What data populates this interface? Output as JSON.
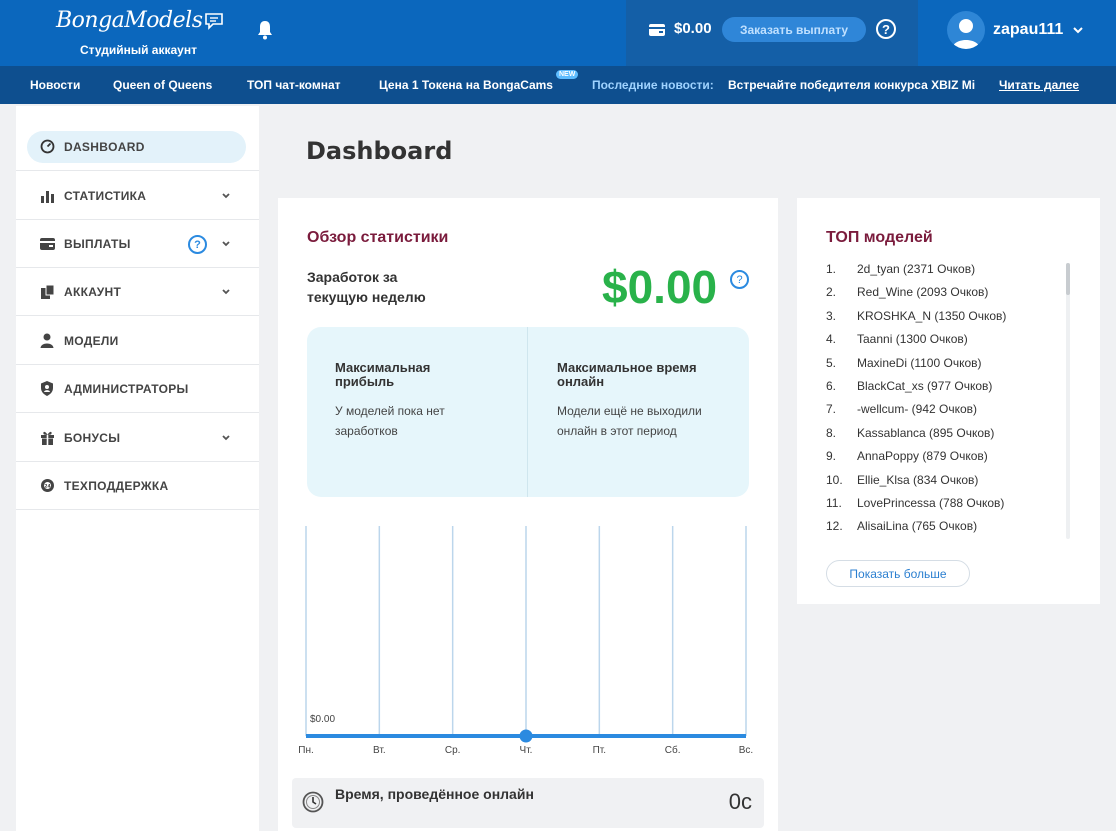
{
  "header": {
    "logo_text": "BongaModels",
    "logo_sub": "Студийный аккаунт",
    "balance": "$0.00",
    "payout_button": "Заказать выплату",
    "help": "?",
    "username": "zapau111",
    "colors": {
      "primary": "#0b67bd",
      "dark": "#0e4f8f"
    }
  },
  "newsbar": {
    "links": [
      "Новости",
      "Queen of Queens",
      "ТОП чат-комнат",
      "Цена 1 Токена на BongaCams"
    ],
    "new_badge": "NEW",
    "label": "Последние новости:",
    "text": "Встречайте победителя конкурса XBIZ Mi",
    "read_more": "Читать далее"
  },
  "sidebar": {
    "items": [
      {
        "label": "DASHBOARD",
        "icon": "dashboard-icon",
        "active": true
      },
      {
        "label": "СТАТИСТИКА",
        "icon": "bar-chart-icon",
        "expandable": true
      },
      {
        "label": "ВЫПЛАТЫ",
        "icon": "card-icon",
        "expandable": true,
        "help": "?"
      },
      {
        "label": "АККАУНТ",
        "icon": "account-icon",
        "expandable": true
      },
      {
        "label": "МОДЕЛИ",
        "icon": "user-icon"
      },
      {
        "label": "АДМИНИСТРАТОРЫ",
        "icon": "shield-icon"
      },
      {
        "label": "БОНУСЫ",
        "icon": "gift-icon",
        "expandable": true
      },
      {
        "label": "ТЕХПОДДЕРЖКА",
        "icon": "support-icon"
      }
    ]
  },
  "main": {
    "title": "Dashboard",
    "stats": {
      "title": "Обзор статистики",
      "earn_label": "Заработок за текущую неделю",
      "earn_value": "$0.00",
      "help": "?",
      "max_profit_title": "Максимальная прибыль",
      "max_profit_text": "У моделей пока нет заработков",
      "max_time_title": "Максимальное время онлайн",
      "max_time_text": "Модели ещё не выходили онлайн в этот период",
      "online_label": "Время, проведённое онлайн",
      "online_value": "0с"
    },
    "top": {
      "title": "ТОП моделей",
      "items": [
        "2d_tyan (2371 Очков)",
        "Red_Wine (2093 Очков)",
        "KROSHKA_N (1350 Очков)",
        "Taanni (1300 Очков)",
        "MaxineDi (1100 Очков)",
        "BlackCat_xs (977 Очков)",
        "-wellcum- (942 Очков)",
        "Kassablanca (895 Очков)",
        "AnnaPoppy (879 Очков)",
        "Ellie_Klsa (834 Очков)",
        "LovePrincessa (788 Очков)",
        "AlisaiLina (765 Очков)"
      ],
      "more_button": "Показать больше"
    }
  },
  "chart_data": {
    "type": "line",
    "categories": [
      "Пн.",
      "Вт.",
      "Ср.",
      "Чт.",
      "Пт.",
      "Сб.",
      "Вс."
    ],
    "values": [
      0,
      0,
      0,
      0,
      0,
      0,
      0
    ],
    "y_label_text": "$0.00",
    "highlight_index": 3,
    "colors": {
      "line": "#2b8ae0",
      "grid": "#bcd6ec"
    }
  }
}
